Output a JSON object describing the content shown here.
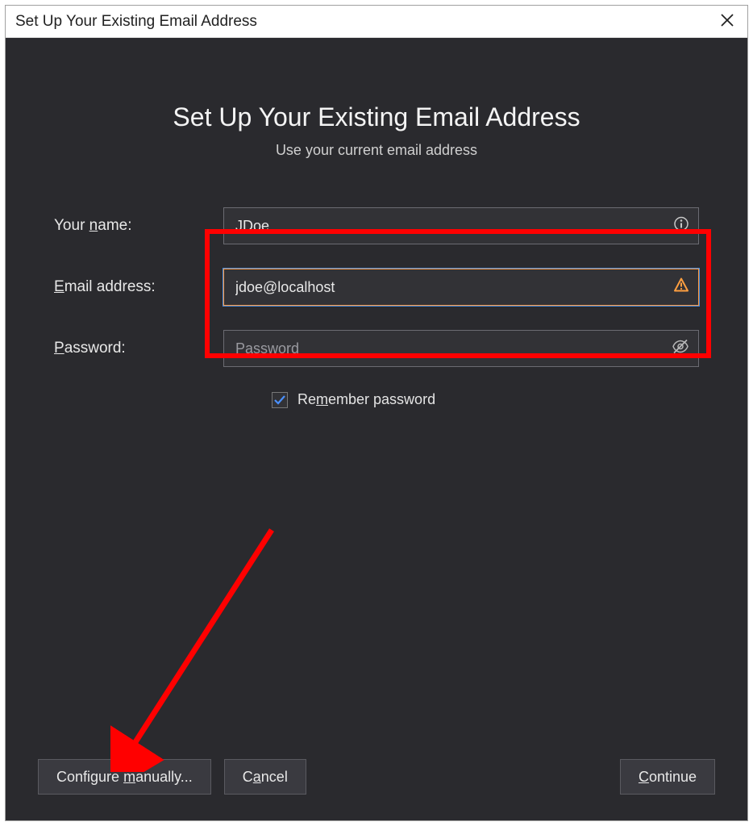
{
  "titlebar": {
    "title": "Set Up Your Existing Email Address"
  },
  "header": {
    "heading": "Set Up Your Existing Email Address",
    "subheading": "Use your current email address"
  },
  "form": {
    "name_label_pre": "Your ",
    "name_label_u": "n",
    "name_label_post": "ame:",
    "name_value": "JDoe",
    "email_label_u": "E",
    "email_label_post": "mail address:",
    "email_value": "jdoe@localhost",
    "password_label_u": "P",
    "password_label_post": "assword:",
    "password_placeholder": "Password",
    "password_value": "",
    "remember_pre": "Re",
    "remember_u": "m",
    "remember_post": "ember password",
    "remember_checked": true
  },
  "buttons": {
    "configure_pre": "Configure ",
    "configure_u": "m",
    "configure_post": "anually...",
    "cancel_pre": "C",
    "cancel_u": "a",
    "cancel_post": "ncel",
    "continue_u": "C",
    "continue_post": "ontinue"
  },
  "annotations": {
    "highlight_color": "#ff0000"
  }
}
